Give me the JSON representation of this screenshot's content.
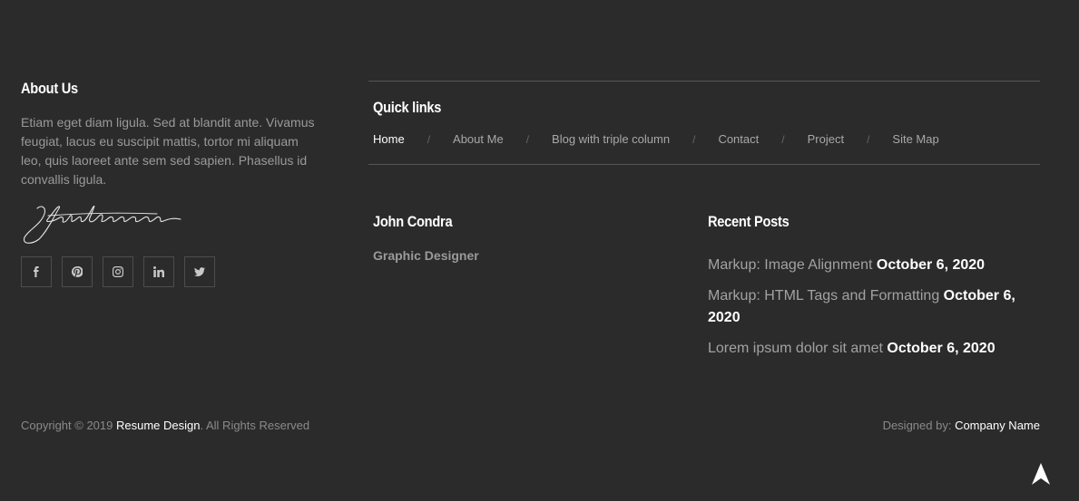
{
  "about": {
    "title": "About Us",
    "text": "Etiam eget diam ligula. Sed at blandit ante. Vivamus feugiat, lacus eu suscipit mattis, tortor mi aliquam leo, quis laoreet ante sem sed sapien. Phasellus id convallis ligula.",
    "signature": "John Lennon",
    "social": [
      {
        "icon": "facebook-icon"
      },
      {
        "icon": "pinterest-icon"
      },
      {
        "icon": "instagram-icon"
      },
      {
        "icon": "linkedin-icon"
      },
      {
        "icon": "twitter-icon"
      }
    ]
  },
  "quick_links": {
    "title": "Quick links",
    "separator": "/",
    "items": [
      {
        "label": "Home",
        "active": true
      },
      {
        "label": "About Me"
      },
      {
        "label": "Blog with triple column"
      },
      {
        "label": "Contact"
      },
      {
        "label": "Project"
      },
      {
        "label": "Site Map"
      }
    ]
  },
  "person": {
    "name": "John Condra",
    "role": "Graphic Designer"
  },
  "recent_posts": {
    "title": "Recent Posts",
    "items": [
      {
        "title": "Markup: Image Alignment",
        "date": "October 6, 2020"
      },
      {
        "title": "Markup: HTML Tags and Formatting",
        "date": "October 6, 2020"
      },
      {
        "title": "Lorem ipsum dolor sit amet",
        "date": "October 6, 2020"
      }
    ]
  },
  "copyright": {
    "prefix": "Copyright © 2019 ",
    "brand": "Resume Design",
    "suffix": ". All Rights Reserved"
  },
  "designed_by": {
    "prefix": "Designed by: ",
    "brand": "Company Name"
  }
}
